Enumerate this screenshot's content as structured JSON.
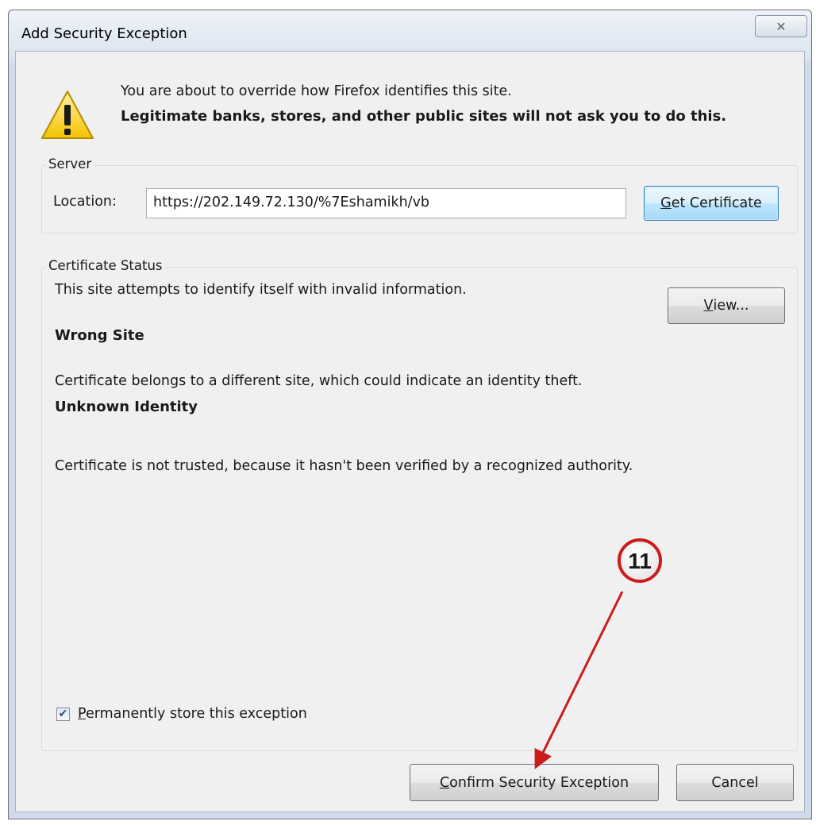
{
  "window": {
    "title": "Add Security Exception",
    "close_glyph": "✕"
  },
  "intro": {
    "line1": "You are about to override how Firefox identifies this site.",
    "line2": "Legitimate banks, stores, and other public sites will not ask you to do this.",
    "icon": "warning-icon"
  },
  "server": {
    "legend": "Server",
    "location_label": "Location:",
    "location_value": "https://202.149.72.130/%7Eshamikh/vb",
    "get_cert_mnemonic": "G",
    "get_cert_rest": "et Certificate"
  },
  "status": {
    "legend": "Certificate Status",
    "text": "This site attempts to identify itself with invalid information.",
    "view_mnemonic": "V",
    "view_rest": "iew...",
    "wrong_site_title": "Wrong Site",
    "wrong_site_desc": "Certificate belongs to a different site, which could indicate an identity theft.",
    "unknown_title": "Unknown Identity",
    "unknown_desc": "Certificate is not trusted, because it hasn't been verified by a recognized authority."
  },
  "permanent": {
    "checked": true,
    "check_glyph": "✔",
    "mnemonic": "P",
    "rest": "ermanently store this exception"
  },
  "buttons": {
    "confirm_mnemonic": "C",
    "confirm_rest": "onfirm Security Exception",
    "cancel": "Cancel"
  },
  "annotation": {
    "step_number": "11",
    "color": "#cc1b1b"
  }
}
